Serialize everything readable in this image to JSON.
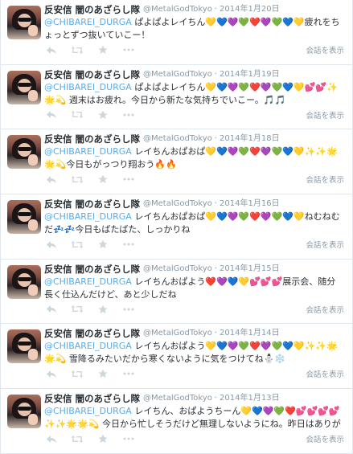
{
  "tweets": [
    {
      "fullname": "反安信 闇のあざらし隊",
      "username": "@MetalGodTokyo",
      "sep": "·",
      "time": "2014年1月20日",
      "mention": "@CHIBAREI_DURGA",
      "text": " ぱよぱよレイちん💛💙💜💚❤️💜💚💙💛疲れをちょっとずつ抜いていこー！",
      "expand": "会話を表示"
    },
    {
      "fullname": "反安信 闇のあざらし隊",
      "username": "@MetalGodTokyo",
      "sep": "·",
      "time": "2014年1月19日",
      "mention": "@CHIBAREI_DURGA",
      "text": " ぱよぱよレイちん💛💙💜💚❤️💜💚💙💛💕💕✨🌟💫 週末はお疲れ。今日から新たな気持ちでいこー。🎵🎵",
      "expand": "会話を表示"
    },
    {
      "fullname": "反安信 闇のあざらし隊",
      "username": "@MetalGodTokyo",
      "sep": "·",
      "time": "2014年1月18日",
      "mention": "@CHIBAREI_DURGA",
      "text": " レイちんおぱおぱ💛💙💜💚❤️💜💚💙💛✨✨🌟🌟💫今日もがっつり翔おう🔥🔥",
      "expand": "会話を表示"
    },
    {
      "fullname": "反安信 闇のあざらし隊",
      "username": "@MetalGodTokyo",
      "sep": "·",
      "time": "2014年1月16日",
      "mention": "@CHIBAREI_DURGA",
      "text": " レイちんおぱおぱ💛💙💜💚❤️💜💚💙💛ねむねむだ💤💤今日もばたばた、しっかりね",
      "expand": "会話を表示"
    },
    {
      "fullname": "反安信 闇のあざらし隊",
      "username": "@MetalGodTokyo",
      "sep": "·",
      "time": "2014年1月15日",
      "mention": "@CHIBAREI_DURGA",
      "text": " レイちんおぱよう❤️💜💙💛💕💕💕展示会、随分長く仕込んだけど、あと少しだね",
      "expand": "会話を表示"
    },
    {
      "fullname": "反安信 闇のあざらし隊",
      "username": "@MetalGodTokyo",
      "sep": "·",
      "time": "2014年1月14日",
      "mention": "@CHIBAREI_DURGA",
      "text": " レイちんおぱよう💛💙💜💚❤️💜💚💙💛✨✨🌟🌟💫 雪降るみたいだから寒くないように気をつけてね⛄❄️",
      "expand": "会話を表示"
    },
    {
      "fullname": "反安信 闇のあざらし隊",
      "username": "@MetalGodTokyo",
      "sep": "·",
      "time": "2014年1月13日",
      "mention": "@CHIBAREI_DURGA",
      "text": " レイちん、おぱようちーん💛💙💜💚❤️💕💕💕💕✨✨🌟🌟💫 今日から忙しそうだけど無理しないようにね。昨日はありがとう！",
      "expand": "会話を表示"
    }
  ]
}
